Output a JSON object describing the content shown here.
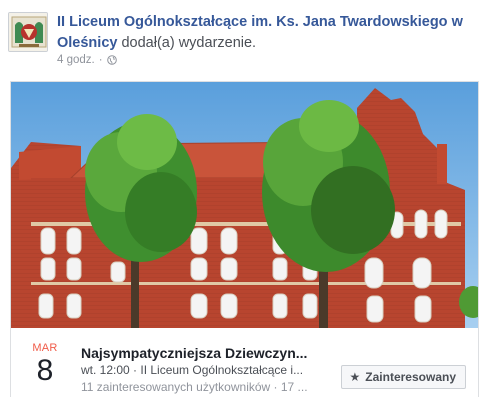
{
  "post": {
    "page_name": "II Liceum Ogólnokształcące im. Ks. Jana Twardowskiego w Oleśnicy",
    "action_text": "dodał(a) wydarzenie.",
    "timestamp": "4 godz.",
    "separator": "·",
    "privacy_icon": "globe-icon"
  },
  "event": {
    "month": "MAR",
    "day": "8",
    "title": "Najsympatyczniejsza Dziewczyn...",
    "time_place": "wt. 12:00 · II Liceum Ogólnokształcące i...",
    "interested": "11 zainteresowanych użytkowników · 17 ...",
    "interested_button": "Zainteresowany",
    "button_icon": "star-icon"
  },
  "colors": {
    "link": "#365899",
    "month": "#f05b48",
    "meta": "#90949c"
  }
}
